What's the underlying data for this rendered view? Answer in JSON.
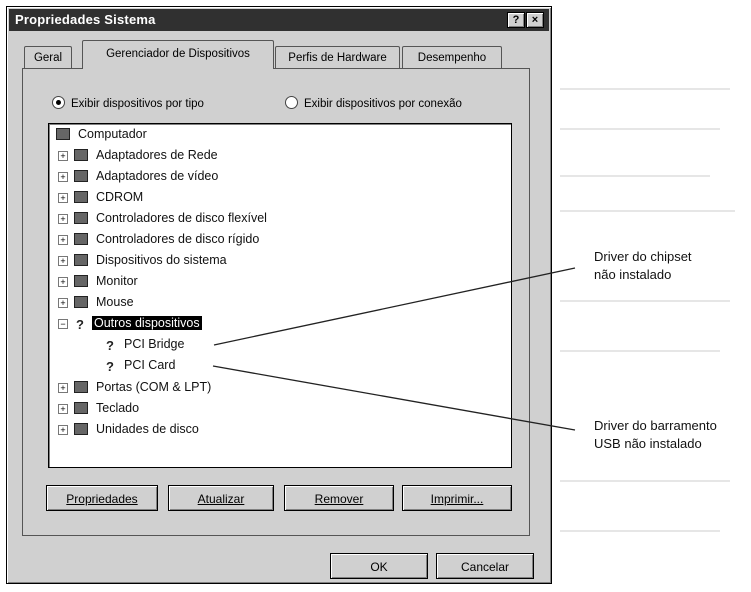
{
  "window": {
    "title": "Propriedades Sistema",
    "help_button": "?",
    "close_button": "×"
  },
  "tabs": [
    {
      "label": "Geral",
      "active": false
    },
    {
      "label": "Gerenciador de Dispositivos",
      "active": true
    },
    {
      "label": "Perfis de Hardware",
      "active": false
    },
    {
      "label": "Desempenho",
      "active": false
    }
  ],
  "view_options": {
    "by_type": "Exibir dispositivos por tipo",
    "by_connection": "Exibir dispositivos por conexão",
    "selected": "by_type"
  },
  "tree": {
    "root": "Computador",
    "items": [
      {
        "label": "Adaptadores de Rede",
        "icon": "network-adapter-icon",
        "expander": "+"
      },
      {
        "label": "Adaptadores de vídeo",
        "icon": "display-adapter-icon",
        "expander": "+"
      },
      {
        "label": "CDROM",
        "icon": "cdrom-icon",
        "expander": "+"
      },
      {
        "label": "Controladores de disco flexível",
        "icon": "floppy-controller-icon",
        "expander": "+"
      },
      {
        "label": "Controladores de disco rígido",
        "icon": "hard-disk-controller-icon",
        "expander": "+"
      },
      {
        "label": "Dispositivos do sistema",
        "icon": "system-devices-icon",
        "expander": "+"
      },
      {
        "label": "Monitor",
        "icon": "monitor-icon",
        "expander": "+"
      },
      {
        "label": "Mouse",
        "icon": "mouse-icon",
        "expander": "+"
      },
      {
        "label": "Outros dispositivos",
        "icon": "unknown-device-icon",
        "expander": "−",
        "selected": true
      },
      {
        "label": "PCI Bridge",
        "icon": "unknown-device-icon",
        "child": true
      },
      {
        "label": "PCI Card",
        "icon": "unknown-device-icon",
        "child": true
      },
      {
        "label": "Portas (COM & LPT)",
        "icon": "port-icon",
        "expander": "+"
      },
      {
        "label": "Teclado",
        "icon": "keyboard-icon",
        "expander": "+"
      },
      {
        "label": "Unidades de disco",
        "icon": "disk-drive-icon",
        "expander": "+"
      }
    ]
  },
  "buttons": {
    "properties": "Propriedades",
    "refresh": "Atualizar",
    "remove": "Remover",
    "print": "Imprimir...",
    "ok": "OK",
    "cancel": "Cancelar"
  },
  "annotations": {
    "chipset_line1": "Driver do chipset",
    "chipset_line2": "não instalado",
    "usb_line1": "Driver do barramento",
    "usb_line2": "USB não instalado"
  }
}
